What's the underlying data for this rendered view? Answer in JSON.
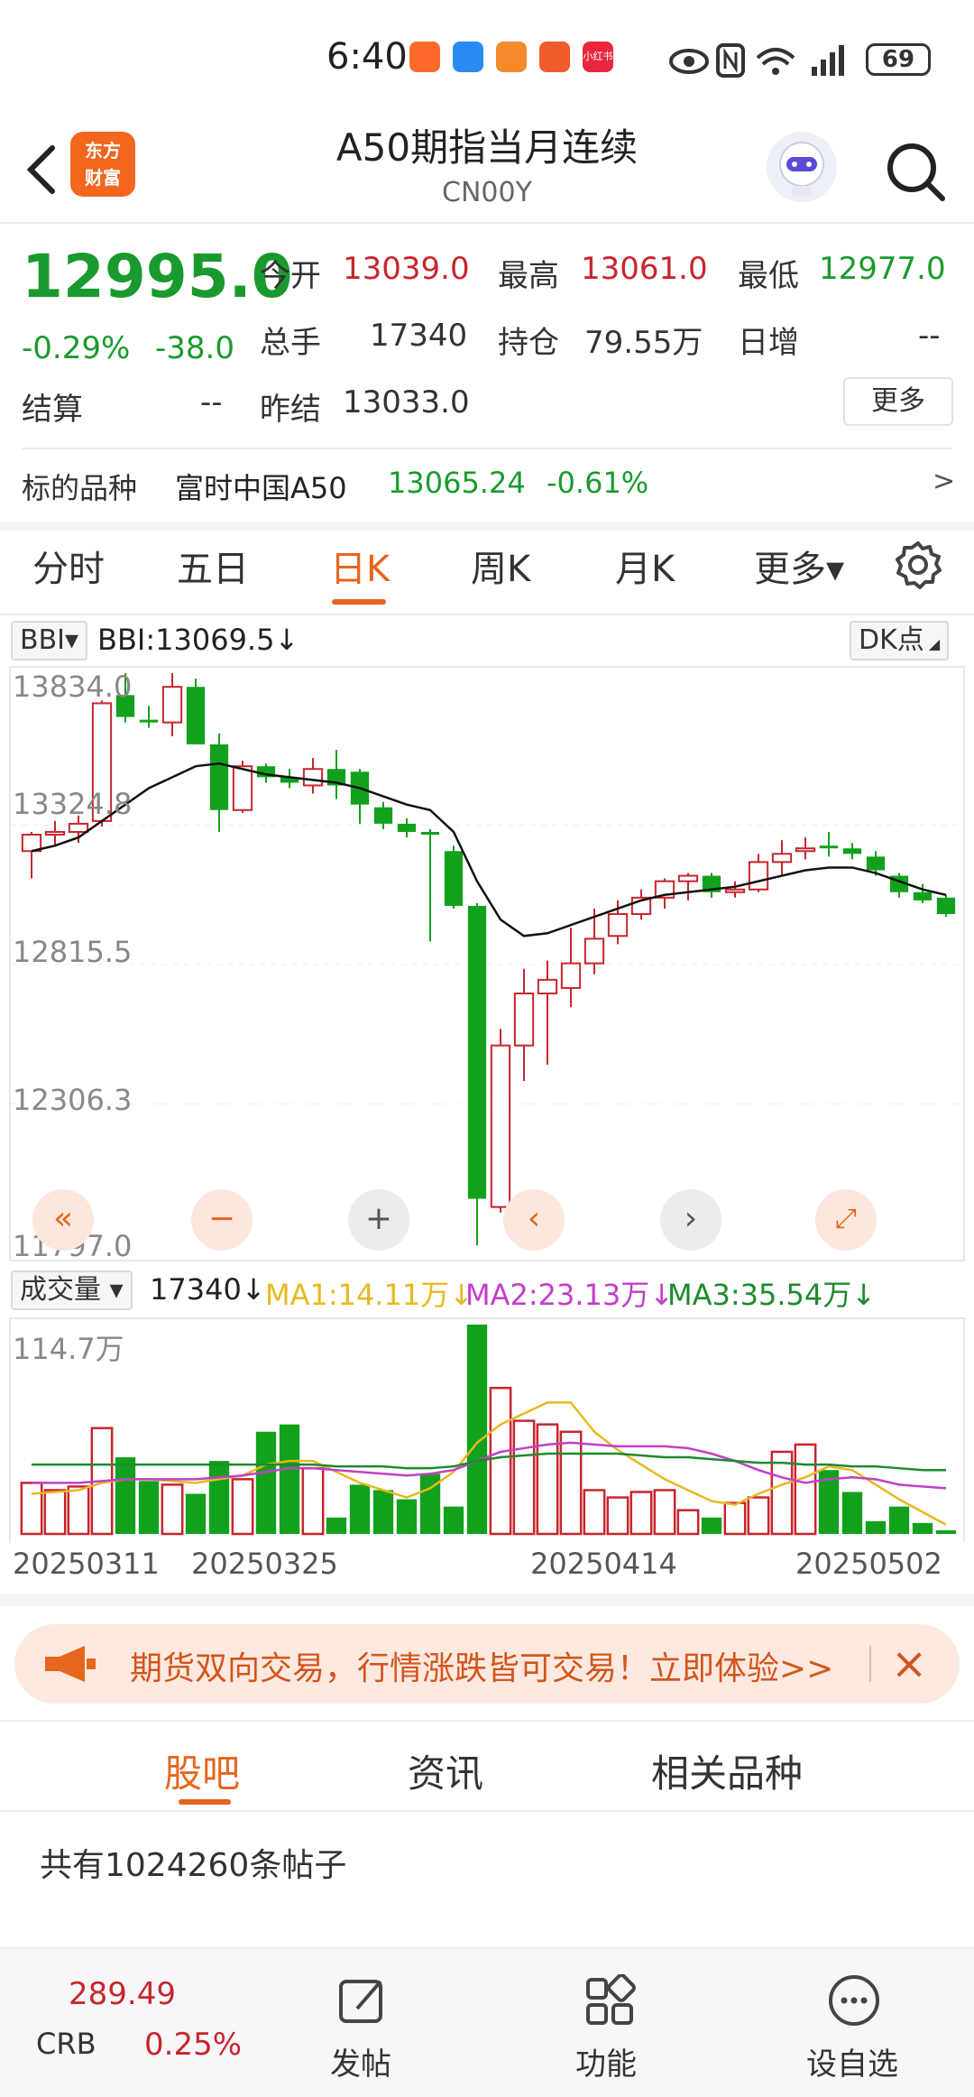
{
  "status_bar": {
    "time": "6:40",
    "battery": "69",
    "apps": [
      {
        "name": "app-icon-1",
        "label": "",
        "color": "#ff6a2b"
      },
      {
        "name": "shield-icon",
        "label": "",
        "color": "#2a8cf2"
      },
      {
        "name": "app-icon-3",
        "label": "",
        "color": "#f58a2b"
      },
      {
        "name": "app-icon-4",
        "label": "",
        "color": "#f05b2b"
      },
      {
        "name": "app-icon-5",
        "label": "小红书",
        "color": "#e8273e"
      }
    ]
  },
  "header": {
    "logo_line1": "东方",
    "logo_line2": "财富",
    "title": "A50期指当月连续",
    "subtitle": "CN00Y"
  },
  "quote": {
    "price": "12995.0",
    "change_pct": "-0.29%",
    "change_abs": "-38.0",
    "rows": [
      [
        {
          "label": "今开",
          "value": "13039.0",
          "color": "red"
        },
        {
          "label": "最高",
          "value": "13061.0",
          "color": "red"
        },
        {
          "label": "最低",
          "value": "12977.0",
          "color": "green"
        }
      ],
      [
        {
          "label": "总手",
          "value": "17340",
          "color": "dark"
        },
        {
          "label": "持仓",
          "value": "79.55万",
          "color": "dark"
        },
        {
          "label": "日增",
          "value": "--",
          "color": "dark"
        }
      ],
      [
        {
          "label": "结算",
          "value": "--",
          "color": "dark"
        },
        {
          "label": "昨结",
          "value": "13033.0",
          "color": "dark"
        }
      ]
    ],
    "more_label": "更多"
  },
  "underlying": {
    "label": "标的品种",
    "name": "富时中国A50",
    "value": "13065.24",
    "change": "-0.61%",
    "arrow": ">"
  },
  "tabs": [
    {
      "label": "分时",
      "active": false
    },
    {
      "label": "五日",
      "active": false
    },
    {
      "label": "日K",
      "active": true
    },
    {
      "label": "周K",
      "active": false
    },
    {
      "label": "月K",
      "active": false
    },
    {
      "label": "更多▾",
      "active": false
    }
  ],
  "indicator": {
    "selector": "BBI▾",
    "value": "BBI:13069.5↓",
    "dk_label": "DK点"
  },
  "volume": {
    "selector": "成交量 ▾",
    "value": "17340↓",
    "ma1": "MA1:14.11万↓",
    "ma2": "MA2:23.13万↓",
    "ma3": "MA3:35.54万↓",
    "max_label": "114.7万",
    "colors": {
      "ma1": "#e8b820",
      "ma2": "#c23fc8",
      "ma3": "#1e8a2e"
    }
  },
  "chart_data": {
    "type": "candlestick",
    "y_ticks": [
      "13834.0",
      "13324.8",
      "12815.5",
      "12306.3",
      "11797.0"
    ],
    "ylim": [
      11797.0,
      13834.0
    ],
    "x_ticks": [
      "20250311",
      "20250325",
      "20250414",
      "20250502"
    ],
    "candles": [
      {
        "o": 13230,
        "h": 13300,
        "l": 13130,
        "c": 13290
      },
      {
        "o": 13290,
        "h": 13340,
        "l": 13250,
        "c": 13300
      },
      {
        "o": 13300,
        "h": 13360,
        "l": 13260,
        "c": 13330
      },
      {
        "o": 13340,
        "h": 13780,
        "l": 13320,
        "c": 13770
      },
      {
        "o": 13800,
        "h": 13880,
        "l": 13700,
        "c": 13720
      },
      {
        "o": 13710,
        "h": 13760,
        "l": 13680,
        "c": 13700
      },
      {
        "o": 13700,
        "h": 13880,
        "l": 13650,
        "c": 13830
      },
      {
        "o": 13830,
        "h": 13860,
        "l": 13620,
        "c": 13620
      },
      {
        "o": 13620,
        "h": 13660,
        "l": 13300,
        "c": 13380
      },
      {
        "o": 13380,
        "h": 13560,
        "l": 13370,
        "c": 13540
      },
      {
        "o": 13540,
        "h": 13550,
        "l": 13480,
        "c": 13500
      },
      {
        "o": 13500,
        "h": 13530,
        "l": 13460,
        "c": 13480
      },
      {
        "o": 13470,
        "h": 13570,
        "l": 13440,
        "c": 13530
      },
      {
        "o": 13530,
        "h": 13600,
        "l": 13420,
        "c": 13470
      },
      {
        "o": 13520,
        "h": 13530,
        "l": 13330,
        "c": 13400
      },
      {
        "o": 13390,
        "h": 13410,
        "l": 13310,
        "c": 13330
      },
      {
        "o": 13330,
        "h": 13350,
        "l": 13280,
        "c": 13300
      },
      {
        "o": 13300,
        "h": 13310,
        "l": 12900,
        "c": 13290
      },
      {
        "o": 13230,
        "h": 13250,
        "l": 13020,
        "c": 13030
      },
      {
        "o": 13030,
        "h": 13040,
        "l": 11790,
        "c": 11960
      },
      {
        "o": 11930,
        "h": 12580,
        "l": 11910,
        "c": 12520
      },
      {
        "o": 12520,
        "h": 12800,
        "l": 12390,
        "c": 12710
      },
      {
        "o": 12710,
        "h": 12830,
        "l": 12450,
        "c": 12760
      },
      {
        "o": 12730,
        "h": 12950,
        "l": 12660,
        "c": 12820
      },
      {
        "o": 12820,
        "h": 13020,
        "l": 12780,
        "c": 12910
      },
      {
        "o": 12920,
        "h": 13050,
        "l": 12890,
        "c": 13000
      },
      {
        "o": 13000,
        "h": 13090,
        "l": 12980,
        "c": 13060
      },
      {
        "o": 13060,
        "h": 13130,
        "l": 13020,
        "c": 13120
      },
      {
        "o": 13120,
        "h": 13150,
        "l": 13050,
        "c": 13140
      },
      {
        "o": 13140,
        "h": 13150,
        "l": 13060,
        "c": 13080
      },
      {
        "o": 13080,
        "h": 13120,
        "l": 13060,
        "c": 13090
      },
      {
        "o": 13090,
        "h": 13220,
        "l": 13080,
        "c": 13190
      },
      {
        "o": 13190,
        "h": 13270,
        "l": 13140,
        "c": 13220
      },
      {
        "o": 13230,
        "h": 13280,
        "l": 13200,
        "c": 13240
      },
      {
        "o": 13250,
        "h": 13300,
        "l": 13210,
        "c": 13240
      },
      {
        "o": 13240,
        "h": 13260,
        "l": 13200,
        "c": 13220
      },
      {
        "o": 13210,
        "h": 13230,
        "l": 13140,
        "c": 13160
      },
      {
        "o": 13140,
        "h": 13150,
        "l": 13060,
        "c": 13080
      },
      {
        "o": 13080,
        "h": 13110,
        "l": 13040,
        "c": 13050
      },
      {
        "o": 13060,
        "h": 13070,
        "l": 12990,
        "c": 13000
      }
    ],
    "bbi": [
      13230,
      13250,
      13280,
      13340,
      13400,
      13460,
      13500,
      13540,
      13550,
      13530,
      13510,
      13500,
      13490,
      13480,
      13460,
      13430,
      13400,
      13380,
      13300,
      13120,
      12980,
      12920,
      12930,
      12960,
      12990,
      13020,
      13050,
      13070,
      13080,
      13090,
      13100,
      13120,
      13140,
      13160,
      13170,
      13170,
      13150,
      13120,
      13090,
      13070
    ],
    "volume": [
      0.28,
      0.24,
      0.26,
      0.58,
      0.42,
      0.29,
      0.27,
      0.22,
      0.4,
      0.3,
      0.56,
      0.6,
      0.36,
      0.09,
      0.27,
      0.24,
      0.19,
      0.33,
      0.15,
      1.147,
      0.8,
      0.62,
      0.6,
      0.56,
      0.24,
      0.2,
      0.23,
      0.24,
      0.13,
      0.09,
      0.17,
      0.2,
      0.45,
      0.49,
      0.35,
      0.23,
      0.07,
      0.15,
      0.06,
      0.02
    ],
    "ma1": [
      0.22,
      0.23,
      0.24,
      0.28,
      0.3,
      0.3,
      0.29,
      0.28,
      0.3,
      0.32,
      0.38,
      0.4,
      0.4,
      0.34,
      0.28,
      0.24,
      0.2,
      0.25,
      0.34,
      0.5,
      0.6,
      0.66,
      0.72,
      0.72,
      0.56,
      0.46,
      0.38,
      0.3,
      0.24,
      0.18,
      0.16,
      0.22,
      0.27,
      0.31,
      0.37,
      0.35,
      0.27,
      0.19,
      0.12,
      0.05
    ],
    "ma2": [
      0.28,
      0.28,
      0.28,
      0.29,
      0.3,
      0.3,
      0.3,
      0.3,
      0.31,
      0.32,
      0.34,
      0.36,
      0.36,
      0.35,
      0.34,
      0.33,
      0.32,
      0.33,
      0.35,
      0.4,
      0.45,
      0.47,
      0.49,
      0.5,
      0.49,
      0.48,
      0.48,
      0.48,
      0.47,
      0.44,
      0.4,
      0.35,
      0.31,
      0.28,
      0.3,
      0.31,
      0.3,
      0.27,
      0.26,
      0.25
    ],
    "ma3": [
      0.38,
      0.38,
      0.38,
      0.38,
      0.38,
      0.38,
      0.38,
      0.38,
      0.38,
      0.38,
      0.38,
      0.38,
      0.38,
      0.37,
      0.37,
      0.37,
      0.36,
      0.36,
      0.37,
      0.4,
      0.42,
      0.43,
      0.44,
      0.44,
      0.44,
      0.44,
      0.43,
      0.42,
      0.42,
      0.41,
      0.4,
      0.39,
      0.39,
      0.38,
      0.38,
      0.37,
      0.37,
      0.36,
      0.35,
      0.35
    ],
    "vol_max": 1.147,
    "up_color": "#c8252d",
    "down_color": "#12a11d",
    "bbi_color": "#111111"
  },
  "ad_banner": {
    "text": "期货双向交易，行情涨跌皆可交易！立即体验>>"
  },
  "bottom_tabs": [
    {
      "label": "股吧",
      "active": true
    },
    {
      "label": "资讯",
      "active": false
    },
    {
      "label": "相关品种",
      "active": false
    }
  ],
  "post_count": "共有1024260条帖子",
  "nav": {
    "crb_value": "289.49",
    "crb_label": "CRB",
    "crb_change": "0.25%",
    "items": [
      "发帖",
      "功能",
      "设自选"
    ]
  },
  "colors": {
    "accent": "#e5661d",
    "up": "#c8252d",
    "down": "#1a9a2e"
  }
}
